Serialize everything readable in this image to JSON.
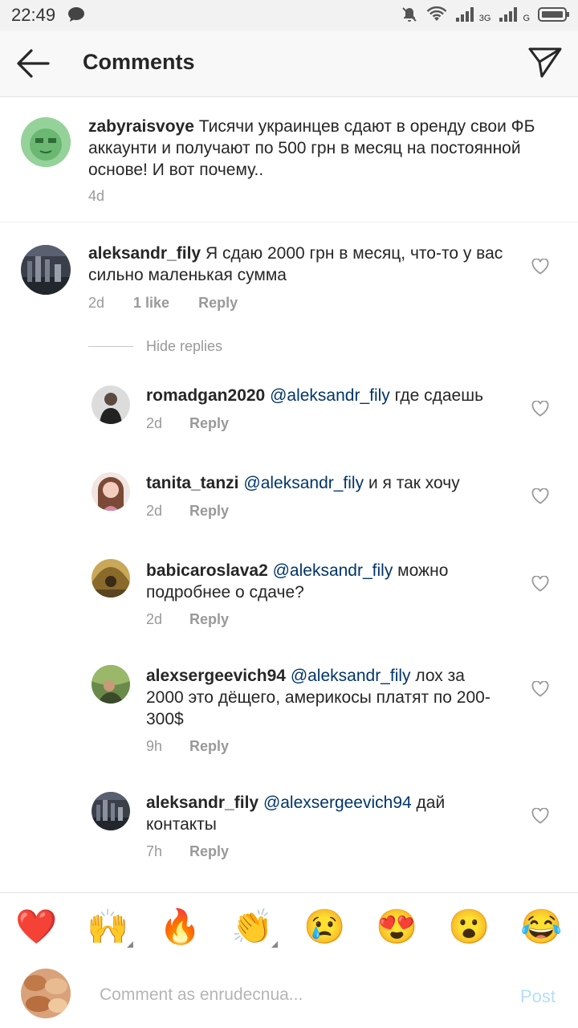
{
  "status_bar": {
    "time": "22:49",
    "net1": "3G",
    "net2": "G"
  },
  "header": {
    "title": "Comments"
  },
  "post": {
    "username": "zabyraisvoye",
    "text": "Тисячи украинцев сдают в оренду свои ФБ аккаунти и получают по 500 грн в месяц на постоянной основе! И вот почему..",
    "time": "4d"
  },
  "comment": {
    "username": "aleksandr_fily",
    "text": "Я сдаю 2000 грн в месяц, что-то у вас сильно маленькая сумма",
    "time": "2d",
    "likes": "1 like",
    "reply_label": "Reply"
  },
  "hide_replies": "Hide replies",
  "replies": [
    {
      "username": "romadgan2020",
      "mention": "@aleksandr_fily",
      "text": "где сдаешь",
      "time": "2d",
      "reply_label": "Reply"
    },
    {
      "username": "tanita_tanzi",
      "mention": "@aleksandr_fily",
      "text": "и я так хочу",
      "time": "2d",
      "reply_label": "Reply"
    },
    {
      "username": "babicaroslava2",
      "mention": "@aleksandr_fily",
      "text": "можно подробнее о сдаче?",
      "time": "2d",
      "reply_label": "Reply"
    },
    {
      "username": "alexsergeevich94",
      "mention": "@aleksandr_fily",
      "text": "лох за 2000 это дёщего, америкосы платят по 200-300$",
      "time": "9h",
      "reply_label": "Reply"
    },
    {
      "username": "aleksandr_fily",
      "mention": "@alexsergeevich94",
      "text": "дай контакты",
      "time": "7h",
      "reply_label": "Reply"
    }
  ],
  "emoji_bar": [
    "❤️",
    "🙌",
    "🔥",
    "👏",
    "😢",
    "😍",
    "😮",
    "😂"
  ],
  "composer": {
    "placeholder": "Comment as enrudecnua...",
    "post_label": "Post"
  },
  "colors": {
    "mention": "#003569",
    "post_disabled": "#b2dffc",
    "meta": "#999999"
  }
}
